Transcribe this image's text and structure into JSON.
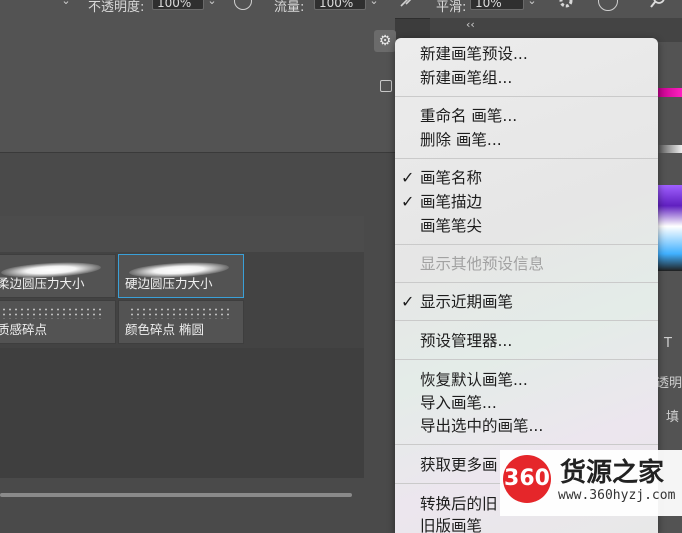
{
  "options_bar": {
    "chevron": "⌄",
    "opacity_label": "不透明度:",
    "opacity_value": "100%",
    "flow_label": "流量:",
    "flow_value": "100%",
    "smoothing_label": "平滑:",
    "smoothing_value": "10%"
  },
  "brush_presets": [
    {
      "name": "柔边圆压力大小",
      "preview": "stroke"
    },
    {
      "name": "硬边圆压力大小",
      "preview": "stroke",
      "selected": true
    },
    {
      "name": "质感碎点",
      "preview": "dots"
    },
    {
      "name": "颜色碎点 椭圆",
      "preview": "dots"
    }
  ],
  "right_panel": {
    "collapse_glyph": "‹‹",
    "labels": [
      "T",
      "透明",
      "填"
    ]
  },
  "flyout_menu": {
    "items": [
      {
        "label": "新建画笔预设...",
        "checked": false,
        "enabled": true
      },
      {
        "label": "新建画笔组...",
        "checked": false,
        "enabled": true
      },
      {
        "label": "重命名 画笔...",
        "checked": false,
        "enabled": true
      },
      {
        "label": "删除 画笔...",
        "checked": false,
        "enabled": true
      },
      {
        "label": "画笔名称",
        "checked": true,
        "enabled": true
      },
      {
        "label": "画笔描边",
        "checked": true,
        "enabled": true
      },
      {
        "label": "画笔笔尖",
        "checked": false,
        "enabled": true
      },
      {
        "label": "显示其他预设信息",
        "checked": false,
        "enabled": false
      },
      {
        "label": "显示近期画笔",
        "checked": true,
        "enabled": true
      },
      {
        "label": "预设管理器...",
        "checked": false,
        "enabled": true
      },
      {
        "label": "恢复默认画笔...",
        "checked": false,
        "enabled": true
      },
      {
        "label": "导入画笔...",
        "checked": false,
        "enabled": true
      },
      {
        "label": "导出选中的画笔...",
        "checked": false,
        "enabled": true
      },
      {
        "label": "获取更多画",
        "checked": false,
        "enabled": true
      },
      {
        "label": "转换后的旧",
        "checked": false,
        "enabled": true
      },
      {
        "label": "旧版画笔",
        "checked": false,
        "enabled": true
      }
    ],
    "check_glyph": "✓"
  },
  "watermark": {
    "logo_text": "360",
    "name": "货源之家",
    "url": "www.360hyzj.com"
  },
  "colors": {
    "selection_border": "#3aa0d8",
    "menu_text": "#1d1d1d",
    "menu_disabled": "#a2a2a2",
    "watermark_red": "#e5262a"
  },
  "icons": [
    "gear-icon",
    "airbrush-icon",
    "pressure-icon",
    "settings-icon",
    "search-icon",
    "panel-toggle-icon"
  ]
}
